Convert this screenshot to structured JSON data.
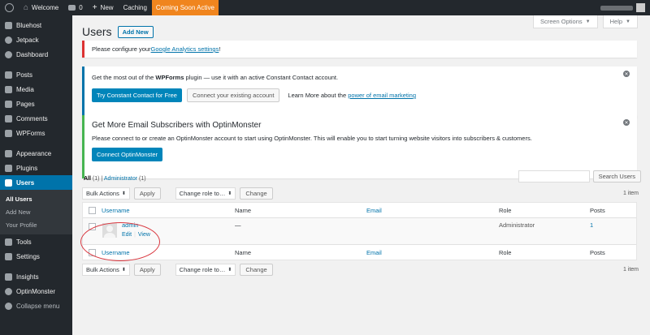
{
  "adminbar": {
    "site_name": "Welcome",
    "comments_count": "0",
    "new_label": "New",
    "caching_label": "Caching",
    "coming_soon_label": "Coming Soon Active"
  },
  "sidebar": {
    "items": [
      {
        "label": "Bluehost",
        "icon": "bluehost-icon"
      },
      {
        "label": "Jetpack",
        "icon": "jetpack-icon"
      },
      {
        "label": "Dashboard",
        "icon": "dashboard-icon"
      },
      {
        "label": "Posts",
        "icon": "pin-icon"
      },
      {
        "label": "Media",
        "icon": "media-icon"
      },
      {
        "label": "Pages",
        "icon": "pages-icon"
      },
      {
        "label": "Comments",
        "icon": "comments-icon"
      },
      {
        "label": "WPForms",
        "icon": "wpforms-icon"
      },
      {
        "label": "Appearance",
        "icon": "appearance-icon"
      },
      {
        "label": "Plugins",
        "icon": "plugins-icon"
      },
      {
        "label": "Users",
        "icon": "users-icon"
      },
      {
        "label": "Tools",
        "icon": "tools-icon"
      },
      {
        "label": "Settings",
        "icon": "settings-icon"
      },
      {
        "label": "Insights",
        "icon": "insights-icon"
      },
      {
        "label": "OptinMonster",
        "icon": "optinmonster-icon"
      },
      {
        "label": "Collapse menu",
        "icon": "collapse-icon"
      }
    ],
    "submenu": [
      "All Users",
      "Add New",
      "Your Profile"
    ]
  },
  "screen_options_label": "Screen Options",
  "help_label": "Help",
  "page": {
    "title": "Users",
    "add_new_label": "Add New"
  },
  "notices": {
    "analytics": {
      "text": "Please configure your ",
      "link": "Google Analytics settings",
      "suffix": "!"
    },
    "wpforms": {
      "text_before": "Get the most out of the ",
      "bold": "WPForms",
      "text_after": " plugin — use it with an active Constant Contact account.",
      "primary_button": "Try Constant Contact for Free",
      "secondary_button": "Connect your existing account",
      "learn_text": "Learn More about the ",
      "learn_link": "power of email marketing"
    },
    "optinmonster": {
      "title": "Get More Email Subscribers with OptinMonster",
      "text": "Please connect to or create an OptinMonster account to start using OptinMonster. This will enable you to start turning website visitors into subscribers & customers.",
      "button": "Connect OptinMonster"
    }
  },
  "views": {
    "all_label": "All",
    "all_count": "(1)",
    "separator": "|",
    "admin_label": "Administrator",
    "admin_count": "(1)"
  },
  "search_button": "Search Users",
  "tablenav": {
    "bulk_actions": "Bulk Actions",
    "apply": "Apply",
    "change_role": "Change role to…",
    "change": "Change",
    "items": "1 item"
  },
  "table": {
    "headers": {
      "username": "Username",
      "name": "Name",
      "email": "Email",
      "role": "Role",
      "posts": "Posts"
    },
    "rows": [
      {
        "username": "admin",
        "name": "—",
        "email": "",
        "role": "Administrator",
        "posts": "1",
        "edit": "Edit",
        "view": "View",
        "action_sep": "|"
      }
    ]
  },
  "colors": {
    "accent": "#0073aa",
    "coming_soon": "#f0851e",
    "highlight_circle": "#d9363e"
  }
}
